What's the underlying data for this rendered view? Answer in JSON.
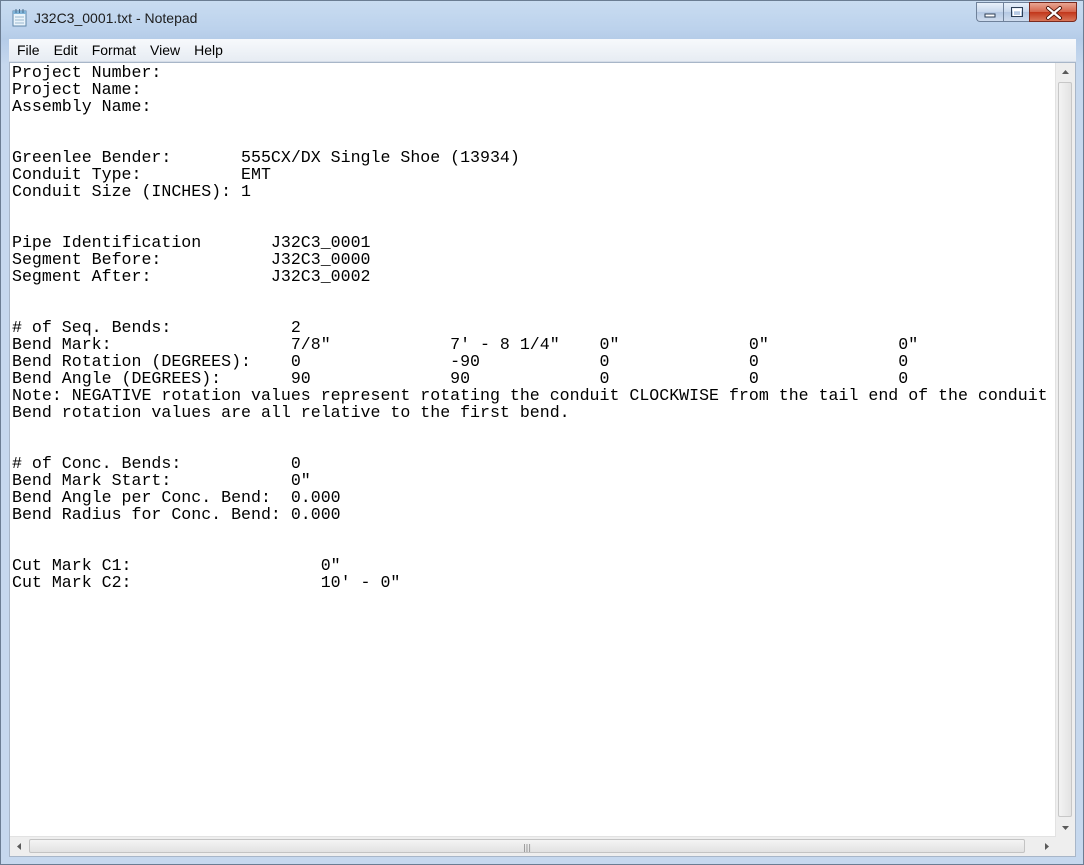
{
  "window": {
    "title": "J32C3_0001.txt - Notepad",
    "icon": "notepad-icon",
    "controls": {
      "minimize_icon": "minimize-icon",
      "maximize_icon": "maximize-icon",
      "close_icon": "close-icon"
    }
  },
  "menu": {
    "items": [
      "File",
      "Edit",
      "Format",
      "View",
      "Help"
    ]
  },
  "document": {
    "lines": [
      "Project Number:",
      "Project Name:",
      "Assembly Name:",
      "",
      "",
      "Greenlee Bender:       555CX/DX Single Shoe (13934)",
      "Conduit Type:          EMT",
      "Conduit Size (INCHES): 1",
      "",
      "",
      "Pipe Identification       J32C3_0001",
      "Segment Before:           J32C3_0000",
      "Segment After:            J32C3_0002",
      "",
      "",
      "# of Seq. Bends:            2",
      "Bend Mark:                  7/8\"            7' - 8 1/4\"    0\"             0\"             0\"",
      "Bend Rotation (DEGREES):    0               -90            0              0              0",
      "Bend Angle (DEGREES):       90              90             0              0              0",
      "Note: NEGATIVE rotation values represent rotating the conduit CLOCKWISE from the tail end of the conduit",
      "Bend rotation values are all relative to the first bend.",
      "",
      "",
      "# of Conc. Bends:           0",
      "Bend Mark Start:            0\"",
      "Bend Angle per Conc. Bend:  0.000",
      "Bend Radius for Conc. Bend: 0.000",
      "",
      "",
      "Cut Mark C1:                   0\"",
      "Cut Mark C2:                   10' - 0\""
    ]
  },
  "scrollbars": {
    "horizontal_grip": "|||"
  }
}
